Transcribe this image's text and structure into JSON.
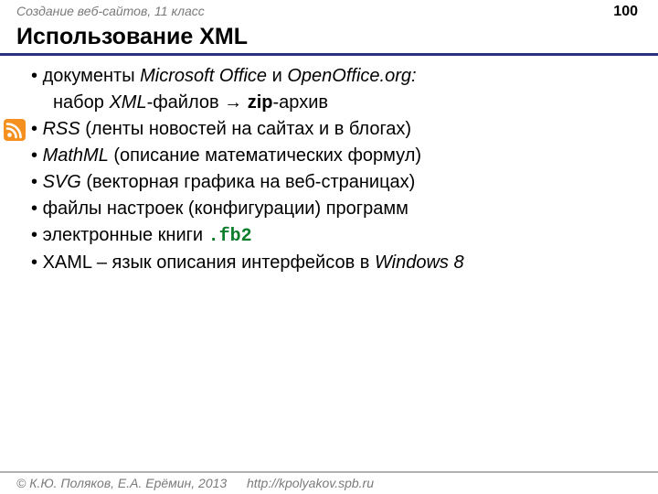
{
  "header": {
    "course": "Создание веб-сайтов, 11 класс",
    "page": "100"
  },
  "title": "Использование XML",
  "bullets": {
    "b1_pre": "документы ",
    "b1_it1": "Microsoft Office",
    "b1_mid": " и ",
    "b1_it2": "OpenOffice.org:",
    "b1_sub_pre": "набор ",
    "b1_sub_it": "XML",
    "b1_sub_mid": "-файлов → ",
    "b1_sub_bold": "zip",
    "b1_sub_post": "-архив",
    "b2_it": "RSS",
    "b2_rest": " (ленты новостей на сайтах и в блогах)",
    "b3_it": "MathML",
    "b3_rest": " (описание математических формул)",
    "b4_it": "SVG",
    "b4_rest": " (векторная графика на веб-страницах)",
    "b5": "файлы настроек (конфигурации) программ",
    "b6_pre": "электронные книги ",
    "b6_code": ".fb2",
    "b7_pre": "XAML – язык описания интерфейсов в ",
    "b7_it": "Windows 8"
  },
  "footer": {
    "copyright": "© К.Ю. Поляков, Е.А. Ерёмин, 2013",
    "url": "http://kpolyakov.spb.ru"
  }
}
